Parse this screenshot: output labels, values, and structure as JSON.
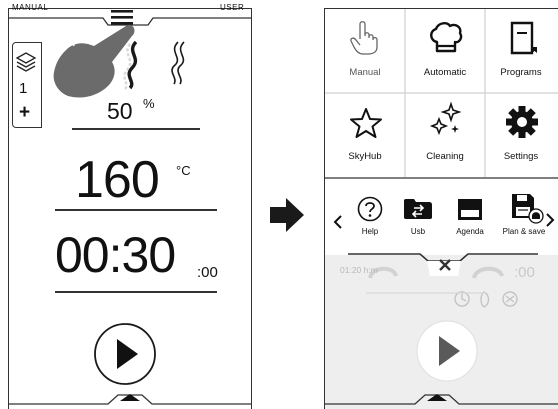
{
  "left_screen": {
    "mode_left": "MANUAL",
    "mode_right": "USER",
    "shelf_count": "1",
    "shelf_add": "+",
    "humidity_value": "50",
    "humidity_unit": "%",
    "temperature_value": "160",
    "temperature_unit": "°C",
    "time_value": "00:30",
    "time_seconds": ":00"
  },
  "right_screen": {
    "menu_tiles": [
      {
        "label": "Manual",
        "icon": "hand-icon"
      },
      {
        "label": "Automatic",
        "icon": "chef-hat-icon"
      },
      {
        "label": "Programs",
        "icon": "book-icon"
      },
      {
        "label": "SkyHub",
        "icon": "star-icon"
      },
      {
        "label": "Cleaning",
        "icon": "sparkles-icon"
      },
      {
        "label": "Settings",
        "icon": "gear-icon"
      }
    ],
    "tools": [
      {
        "label": "Help",
        "icon": "help-icon"
      },
      {
        "label": "Usb",
        "icon": "usb-folder-icon"
      },
      {
        "label": "Agenda",
        "icon": "agenda-icon"
      },
      {
        "label": "Plan & save",
        "icon": "plan-save-icon"
      }
    ],
    "background_time": "01:20 h:m",
    "background_unit": ":00"
  },
  "colors": {
    "line": "#333333",
    "dark_icon": "#1a1a1a",
    "faded_background": "#eeeeee",
    "faded_text": "#b9b9b9",
    "hand_gesture": "#6b6b6b"
  }
}
